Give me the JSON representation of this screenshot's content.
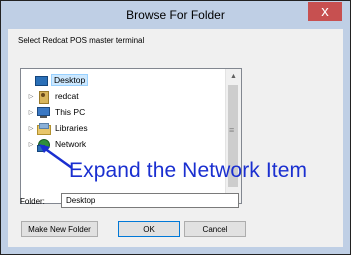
{
  "dialog": {
    "title": "Browse For Folder",
    "close_glyph": "x",
    "instruction": "Select Redcat POS master terminal"
  },
  "tree": {
    "items": [
      {
        "label": "Desktop",
        "icon": "desktop-icon",
        "selected": true
      },
      {
        "label": "redcat",
        "icon": "user-folder-icon"
      },
      {
        "label": "This PC",
        "icon": "computer-icon"
      },
      {
        "label": "Libraries",
        "icon": "libraries-icon"
      },
      {
        "label": "Network",
        "icon": "network-icon"
      }
    ],
    "expander_glyph": "▷"
  },
  "folder": {
    "label": "Folder:",
    "value": "Desktop"
  },
  "buttons": {
    "new_folder": "Make New Folder",
    "ok": "OK",
    "cancel": "Cancel"
  },
  "annotation": {
    "text": "Expand the Network Item",
    "color": "#1a2fd0"
  }
}
